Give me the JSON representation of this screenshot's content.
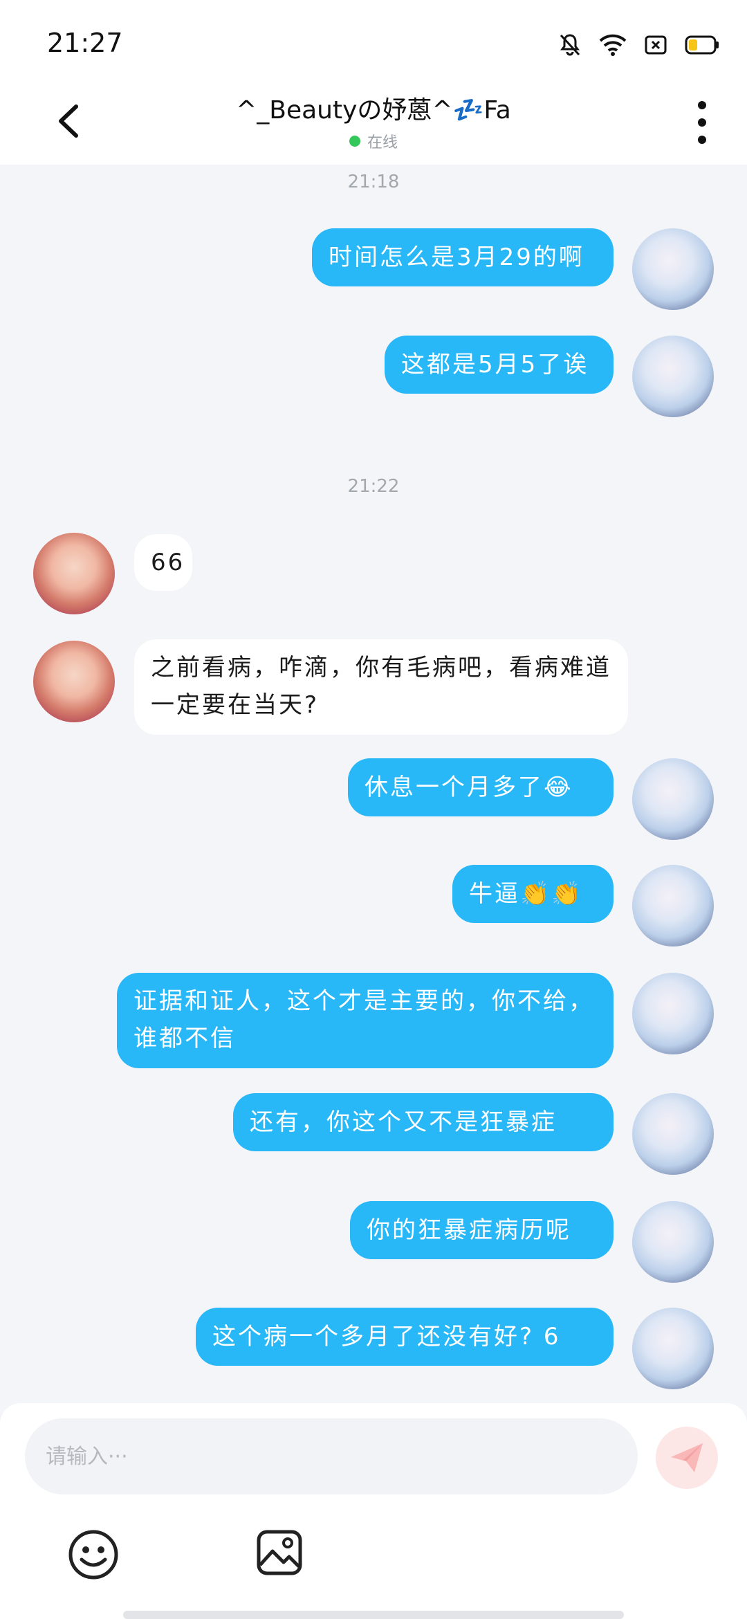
{
  "status_bar": {
    "time": "21:27",
    "icons": [
      "bell-off-icon",
      "wifi-icon",
      "sim-icon",
      "battery-icon"
    ]
  },
  "header": {
    "title": "^_Beautyの妤蒽^💤Fa",
    "status": "在线",
    "status_color": "#34c759"
  },
  "colors": {
    "bubble_me": "#28b7f7",
    "bubble_other": "#ffffff",
    "background": "#f3f5f8"
  },
  "messages": {
    "t1": "21:18",
    "m1": "时间怎么是3月29的啊",
    "m2": "这都是5月5了诶",
    "t2": "21:22",
    "m3": "66",
    "m4": "之前看病，咋滴，你有毛病吧，看病难道一定要在当天?",
    "m5": "休息一个月多了😂",
    "m6": "牛逼👏👏",
    "m7": "证据和证人，这个才是主要的，你不给，谁都不信",
    "m8": "还有，你这个又不是狂暴症",
    "m9": "你的狂暴症病历呢",
    "m10": "这个病一个多月了还没有好? 6"
  },
  "composer": {
    "placeholder": "请输入···"
  }
}
